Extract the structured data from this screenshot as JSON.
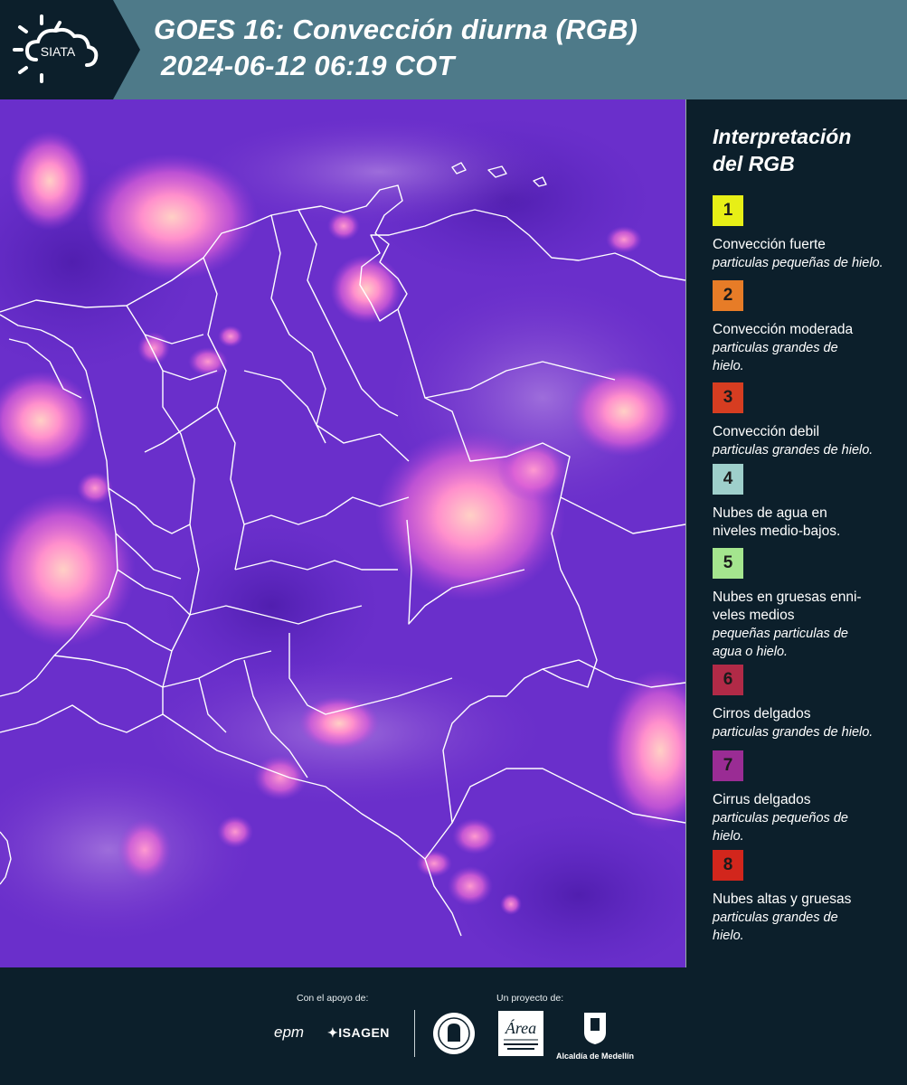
{
  "header": {
    "logo_text": "SIATA",
    "title_line1": "GOES 16: Convección diurna (RGB)",
    "title_line2": "2024-06-12 06:19 COT",
    "colors": {
      "header_bg": "#4e7a89",
      "dark_bg": "#0c1f2b"
    }
  },
  "legend": {
    "title_line1": "Interpretación",
    "title_line2": "del RGB",
    "items": [
      {
        "number": "1",
        "color": "#e7ef16",
        "name": "Convección fuerte",
        "desc": "particulas pequeñas de hielo."
      },
      {
        "number": "2",
        "color": "#e77c27",
        "name": "Convección moderada",
        "desc": "particulas grandes de hielo."
      },
      {
        "number": "3",
        "color": "#d63d21",
        "name": "Convección debil",
        "desc": "particulas grandes de hielo."
      },
      {
        "number": "4",
        "color": "#9ecfcb",
        "name": "Nubes de agua en niveles medio-bajos.",
        "desc": ""
      },
      {
        "number": "5",
        "color": "#a4e58e",
        "name": "Nubes en gruesas enni-veles medios",
        "desc": "pequeñas particulas de agua o hielo."
      },
      {
        "number": "6",
        "color": "#b12a47",
        "name": "Cirros delgados",
        "desc": "particulas grandes de hielo."
      },
      {
        "number": "7",
        "color": "#9a2c94",
        "name": "Cirrus delgados",
        "desc": "particulas pequeños de hielo."
      },
      {
        "number": "8",
        "color": "#d2261c",
        "name": "Nubes altas y gruesas",
        "desc": "particulas grandes de hielo."
      }
    ]
  },
  "footer": {
    "support_label": "Con el apoyo de:",
    "project_label": "Un proyecto de:",
    "sponsors": [
      "epm",
      "ISAGEN"
    ],
    "partners": [
      "Área Metropolitana Valle de Aburrá",
      "Alcaldía de Medellín"
    ]
  }
}
